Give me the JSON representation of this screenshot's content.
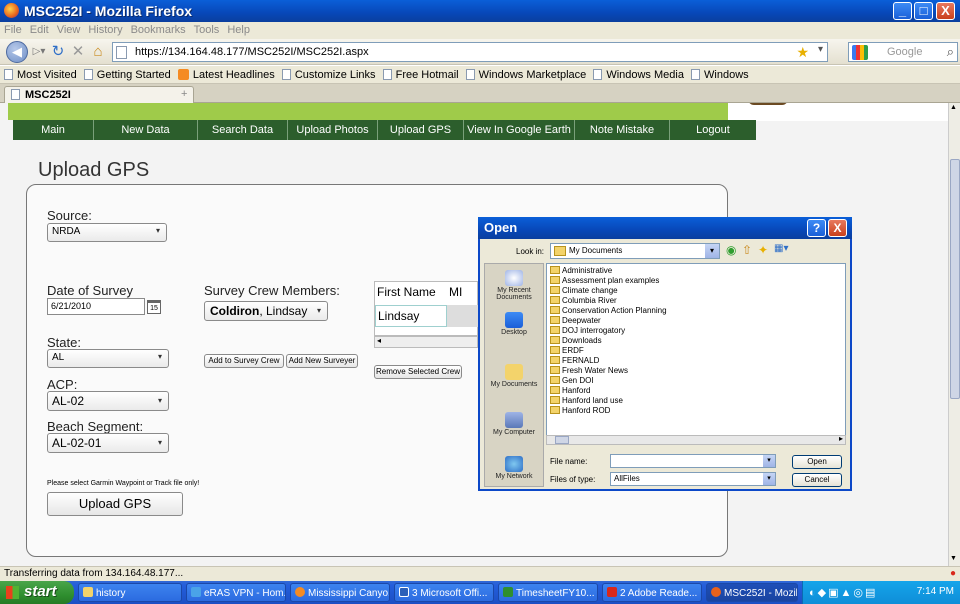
{
  "window": {
    "title": "MSC252I - Mozilla Firefox",
    "min_label": "_",
    "max_label": "□",
    "close_label": "X"
  },
  "menu": [
    "File",
    "Edit",
    "View",
    "History",
    "Bookmarks",
    "Tools",
    "Help"
  ],
  "toolbar": {
    "url": "https://134.164.48.177/MSC252I/MSC252I.aspx",
    "search_placeholder": "Google"
  },
  "bookmarks": [
    {
      "label": "Most Visited",
      "icon": "page-icon"
    },
    {
      "label": "Getting Started",
      "icon": "page-icon"
    },
    {
      "label": "Latest Headlines",
      "icon": "rss-icon"
    },
    {
      "label": "Customize Links",
      "icon": "page-icon"
    },
    {
      "label": "Free Hotmail",
      "icon": "page-icon"
    },
    {
      "label": "Windows Marketplace",
      "icon": "page-icon"
    },
    {
      "label": "Windows Media",
      "icon": "page-icon"
    },
    {
      "label": "Windows",
      "icon": "page-icon"
    }
  ],
  "tab": {
    "label": "MSC252I",
    "new_tab_label": "+"
  },
  "nav_menu": [
    "Main",
    "New Data",
    "Search Data",
    "Upload Photos",
    "Upload GPS",
    "View In Google Earth",
    "Note Mistake",
    "Logout"
  ],
  "page": {
    "heading": "Upload GPS",
    "source_label": "Source:",
    "source_value": "NRDA",
    "date_label": "Date of Survey",
    "date_value": "6/21/2010",
    "calendar_label": "15",
    "crew_label": "Survey Crew Members:",
    "crew_surname": "Coldiron",
    "crew_given": ", Lindsay",
    "add_crew_button": "Add to Survey Crew",
    "add_surveyer_button": "Add New Surveyer",
    "remove_crew_button": "Remove Selected Crew",
    "table_headers": [
      "First Name",
      "MI"
    ],
    "table_rows": [
      [
        "Lindsay",
        ""
      ]
    ],
    "state_label": "State:",
    "state_value": "AL",
    "acp_label": "ACP:",
    "acp_value": "AL-02",
    "segment_label": "Beach Segment:",
    "segment_value": "AL-02-01",
    "note": "Please select Garmin Waypoint or Track file only!",
    "upload_button": "Upload GPS"
  },
  "dialog": {
    "title": "Open",
    "help_label": "?",
    "close_label": "X",
    "look_in_label": "Look in:",
    "look_in_value": "My Documents",
    "places": [
      "My Recent Documents",
      "Desktop",
      "My Documents",
      "My Computer",
      "My Network"
    ],
    "files": [
      "Administrative",
      "Assessment plan examples",
      "Climate change",
      "Columbia River",
      "Conservation Action Planning",
      "Deepwater",
      "DOJ interrogatory",
      "Downloads",
      "ERDF",
      "FERNALD",
      "Fresh Water News",
      "Gen DOI",
      "Hanford",
      "Hanford land use",
      "Hanford ROD"
    ],
    "file_name_label": "File name:",
    "file_name_value": "",
    "file_type_label": "Files of type:",
    "file_type_value": "AllFiles",
    "open_button": "Open",
    "cancel_button": "Cancel"
  },
  "status": "Transferring data from 134.164.48.177...",
  "taskbar": {
    "start_label": "start",
    "tasks": [
      {
        "label": "history",
        "color": "#f3d36b"
      },
      {
        "label": "eRAS VPN - Hom...",
        "color": "#4aa3e8"
      },
      {
        "label": "Mississippi Canyo...",
        "color": "#f58b22"
      },
      {
        "label": "3 Microsoft Offi...",
        "color": "#2b5fb8"
      },
      {
        "label": "TimesheetFY10...",
        "color": "#2f8f2f"
      },
      {
        "label": "2 Adobe Reade...",
        "color": "#d8281c"
      },
      {
        "label": "MSC252I - Mozill...",
        "color": "#e8621c"
      }
    ],
    "clock": "7:14 PM"
  }
}
